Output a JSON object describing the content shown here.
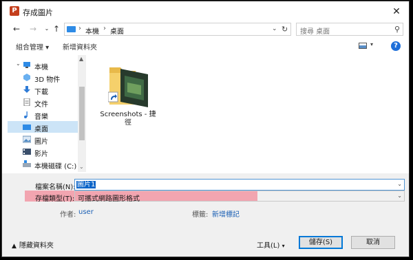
{
  "window": {
    "title": "存成圖片",
    "app_icon_letter": "P",
    "close_glyph": "✕"
  },
  "address": {
    "path": [
      "本機",
      "桌面"
    ],
    "sep": "›",
    "search_placeholder": "搜尋 桌面"
  },
  "toolbar": {
    "organize": "組合管理 ▾",
    "new_folder": "新增資料夾",
    "help": "?"
  },
  "nav": {
    "items": [
      {
        "label": "本機",
        "icon": "computer-icon"
      },
      {
        "label": "3D 物件",
        "icon": "cube-icon"
      },
      {
        "label": "下載",
        "icon": "download-icon"
      },
      {
        "label": "文件",
        "icon": "document-icon"
      },
      {
        "label": "音樂",
        "icon": "music-icon"
      },
      {
        "label": "桌面",
        "icon": "desktop-icon",
        "selected": true
      },
      {
        "label": "圖片",
        "icon": "pictures-icon"
      },
      {
        "label": "影片",
        "icon": "video-icon"
      },
      {
        "label": "本機磁碟 (C:)",
        "icon": "drive-icon"
      }
    ]
  },
  "files": [
    {
      "name": "Screenshots - 捷徑",
      "icon": "folder-shortcut-icon"
    }
  ],
  "form": {
    "filename_label": "檔案名稱(N):",
    "filename_value": "圖片1",
    "filetype_label": "存檔類型(T):",
    "filetype_value": "可攜式網路圖形格式",
    "author_label": "作者:",
    "author_value": "user",
    "tags_label": "標籤:",
    "tags_value": "新增標記"
  },
  "footer": {
    "hide_folders": "隱藏資料夾",
    "tools": "工具(L)",
    "save": "儲存(S)",
    "cancel": "取消"
  },
  "colors": {
    "accent": "#0078d7",
    "highlight": "#f2a5b0",
    "selection": "#cce4f7"
  }
}
